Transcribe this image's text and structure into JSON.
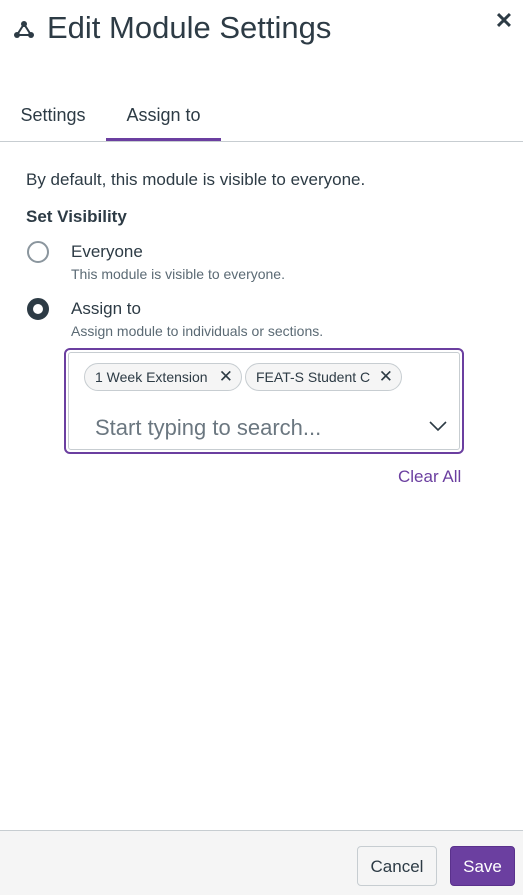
{
  "header": {
    "title": "Edit Module Settings",
    "title_icon": "module-icon",
    "close_icon": "close-icon"
  },
  "tabs": [
    {
      "label": "Settings",
      "selected": false
    },
    {
      "label": "Assign to",
      "selected": true
    }
  ],
  "content": {
    "intro": "By default, this module is visible to everyone.",
    "visibility_label": "Set Visibility",
    "options": [
      {
        "label": "Everyone",
        "description": "This module is visible to everyone.",
        "selected": false
      },
      {
        "label": "Assign to",
        "description": "Assign module to individuals or sections.",
        "selected": true
      }
    ],
    "assign": {
      "chips": [
        {
          "label": "1 Week Extension"
        },
        {
          "label": "FEAT-S Student C"
        }
      ],
      "placeholder": "Start typing to search...",
      "clear_all": "Clear All"
    }
  },
  "footer": {
    "cancel_label": "Cancel",
    "save_label": "Save"
  },
  "colors": {
    "accent": "#6b3fa0",
    "text": "#2d3b45",
    "border": "#c7cdd1"
  }
}
